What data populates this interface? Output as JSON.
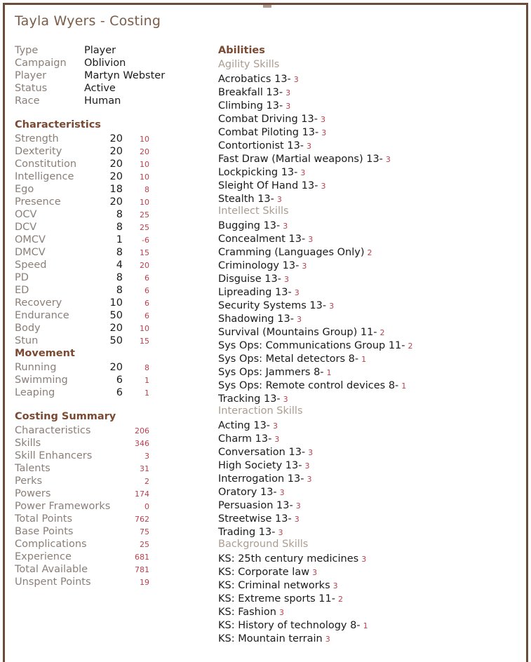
{
  "page_title": "Tayla Wyers - Costing",
  "info": {
    "rows": [
      {
        "label": "Type",
        "value": "Player"
      },
      {
        "label": "Campaign",
        "value": "Oblivion"
      },
      {
        "label": "Player",
        "value": "Martyn Webster"
      },
      {
        "label": "Status",
        "value": "Active"
      },
      {
        "label": "Race",
        "value": "Human"
      }
    ]
  },
  "characteristics": {
    "heading": "Characteristics",
    "rows": [
      {
        "label": "Strength",
        "value": "20",
        "cost": "10"
      },
      {
        "label": "Dexterity",
        "value": "20",
        "cost": "20"
      },
      {
        "label": "Constitution",
        "value": "20",
        "cost": "10"
      },
      {
        "label": "Intelligence",
        "value": "20",
        "cost": "10"
      },
      {
        "label": "Ego",
        "value": "18",
        "cost": "8"
      },
      {
        "label": "Presence",
        "value": "20",
        "cost": "10"
      },
      {
        "label": "OCV",
        "value": "8",
        "cost": "25"
      },
      {
        "label": "DCV",
        "value": "8",
        "cost": "25"
      },
      {
        "label": "OMCV",
        "value": "1",
        "cost": "-6"
      },
      {
        "label": "DMCV",
        "value": "8",
        "cost": "15"
      },
      {
        "label": "Speed",
        "value": "4",
        "cost": "20"
      },
      {
        "label": "PD",
        "value": "8",
        "cost": "6"
      },
      {
        "label": "ED",
        "value": "8",
        "cost": "6"
      },
      {
        "label": "Recovery",
        "value": "10",
        "cost": "6"
      },
      {
        "label": "Endurance",
        "value": "50",
        "cost": "6"
      },
      {
        "label": "Body",
        "value": "20",
        "cost": "10"
      },
      {
        "label": "Stun",
        "value": "50",
        "cost": "15"
      }
    ]
  },
  "movement": {
    "heading": "Movement",
    "rows": [
      {
        "label": "Running",
        "value": "20",
        "cost": "8"
      },
      {
        "label": "Swimming",
        "value": "6",
        "cost": "1"
      },
      {
        "label": "Leaping",
        "value": "6",
        "cost": "1"
      }
    ]
  },
  "costing_summary": {
    "heading": "Costing Summary",
    "rows": [
      {
        "label": "Characteristics",
        "cost": "206"
      },
      {
        "label": "Skills",
        "cost": "346"
      },
      {
        "label": "Skill Enhancers",
        "cost": "3"
      },
      {
        "label": "Talents",
        "cost": "31"
      },
      {
        "label": "Perks",
        "cost": "2"
      },
      {
        "label": "Powers",
        "cost": "174"
      },
      {
        "label": "Power Frameworks",
        "cost": "0"
      },
      {
        "label": "Total Points",
        "cost": "762"
      },
      {
        "label": "Base Points",
        "cost": "75"
      },
      {
        "label": "Complications",
        "cost": "25"
      },
      {
        "label": "Experience",
        "cost": "681"
      },
      {
        "label": "Total Available",
        "cost": "781"
      },
      {
        "label": "Unspent Points",
        "cost": "19"
      }
    ]
  },
  "abilities": {
    "heading": "Abilities",
    "groups": [
      {
        "name": "Agility Skills",
        "items": [
          {
            "name": "Acrobatics 13-",
            "cost": "3"
          },
          {
            "name": "Breakfall 13-",
            "cost": "3"
          },
          {
            "name": "Climbing 13-",
            "cost": "3"
          },
          {
            "name": "Combat Driving 13-",
            "cost": "3"
          },
          {
            "name": "Combat Piloting 13-",
            "cost": "3"
          },
          {
            "name": "Contortionist 13-",
            "cost": "3"
          },
          {
            "name": "Fast Draw (Martial weapons) 13-",
            "cost": "3"
          },
          {
            "name": "Lockpicking 13-",
            "cost": "3"
          },
          {
            "name": "Sleight Of Hand 13-",
            "cost": "3"
          },
          {
            "name": "Stealth 13-",
            "cost": "3"
          }
        ]
      },
      {
        "name": "Intellect Skills",
        "items": [
          {
            "name": "Bugging 13-",
            "cost": "3"
          },
          {
            "name": "Concealment 13-",
            "cost": "3"
          },
          {
            "name": "Cramming (Languages Only)",
            "cost": "2"
          },
          {
            "name": "Criminology 13-",
            "cost": "3"
          },
          {
            "name": "Disguise 13-",
            "cost": "3"
          },
          {
            "name": "Lipreading 13-",
            "cost": "3"
          },
          {
            "name": "Security Systems 13-",
            "cost": "3"
          },
          {
            "name": "Shadowing 13-",
            "cost": "3"
          },
          {
            "name": "Survival (Mountains Group) 11-",
            "cost": "2"
          },
          {
            "name": "Sys Ops: Communications Group 11-",
            "cost": "2"
          },
          {
            "name": "Sys Ops: Metal detectors 8-",
            "cost": "1"
          },
          {
            "name": "Sys Ops: Jammers 8-",
            "cost": "1"
          },
          {
            "name": "Sys Ops: Remote control devices 8-",
            "cost": "1"
          },
          {
            "name": "Tracking 13-",
            "cost": "3"
          }
        ]
      },
      {
        "name": "Interaction Skills",
        "items": [
          {
            "name": "Acting 13-",
            "cost": "3"
          },
          {
            "name": "Charm 13-",
            "cost": "3"
          },
          {
            "name": "Conversation 13-",
            "cost": "3"
          },
          {
            "name": "High Society 13-",
            "cost": "3"
          },
          {
            "name": "Interrogation 13-",
            "cost": "3"
          },
          {
            "name": "Oratory 13-",
            "cost": "3"
          },
          {
            "name": "Persuasion 13-",
            "cost": "3"
          },
          {
            "name": "Streetwise 13-",
            "cost": "3"
          },
          {
            "name": "Trading 13-",
            "cost": "3"
          }
        ]
      },
      {
        "name": "Background Skills",
        "items": [
          {
            "name": "KS: 25th century medicines",
            "cost": "3"
          },
          {
            "name": "KS: Corporate law",
            "cost": "3"
          },
          {
            "name": "KS: Criminal networks",
            "cost": "3"
          },
          {
            "name": "KS: Extreme sports 11-",
            "cost": "2"
          },
          {
            "name": "KS: Fashion",
            "cost": "3"
          },
          {
            "name": "KS: History of technology 8-",
            "cost": "1"
          },
          {
            "name": "KS: Mountain terrain",
            "cost": "3"
          }
        ]
      }
    ]
  }
}
